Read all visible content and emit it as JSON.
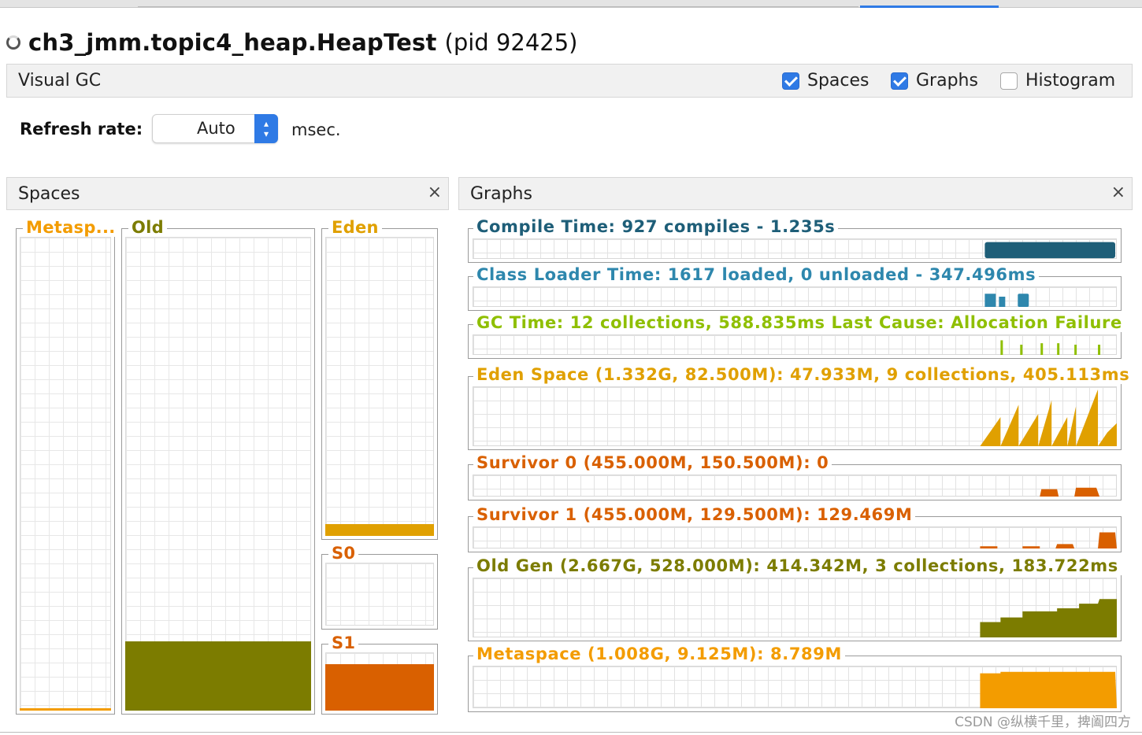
{
  "window": {
    "title_main": "ch3_jmm.topic4_heap.HeapTest",
    "title_pid": "(pid 92425)"
  },
  "plugin_bar": {
    "title": "Visual GC",
    "checkboxes": [
      {
        "label": "Spaces",
        "checked": true
      },
      {
        "label": "Graphs",
        "checked": true
      },
      {
        "label": "Histogram",
        "checked": false
      }
    ]
  },
  "refresh": {
    "label": "Refresh rate:",
    "value": "Auto",
    "unit": "msec."
  },
  "spaces_panel": {
    "title": "Spaces",
    "close": "×",
    "spaces": [
      {
        "key": "metaspace",
        "label": "Metasp...",
        "color": "#f39c00",
        "fill": 0.005
      },
      {
        "key": "old",
        "label": "Old",
        "color": "#7c7c00",
        "fill": 0.147
      },
      {
        "key": "eden",
        "label": "Eden",
        "color": "#e0a000",
        "fill": 0.04
      },
      {
        "key": "s0",
        "label": "S0",
        "color": "#d96000",
        "fill": 0.0
      },
      {
        "key": "s1",
        "label": "S1",
        "color": "#d96000",
        "fill": 0.8
      }
    ]
  },
  "graphs_panel": {
    "title": "Graphs",
    "close": "×",
    "graphs": [
      {
        "key": "compile",
        "label": "Compile Time: 927 compiles - 1.235s",
        "color": "#1e5e78"
      },
      {
        "key": "classloader",
        "label": "Class Loader Time: 1617 loaded, 0 unloaded - 347.496ms",
        "color": "#2e87ad"
      },
      {
        "key": "gc",
        "label": "GC Time: 12 collections, 588.835ms Last Cause: Allocation Failure",
        "color": "#8fbf00"
      },
      {
        "key": "eden",
        "label": "Eden Space (1.332G, 82.500M): 47.933M, 9 collections, 405.113ms",
        "color": "#e0a000"
      },
      {
        "key": "s0",
        "label": "Survivor 0 (455.000M, 150.500M): 0",
        "color": "#d96000"
      },
      {
        "key": "s1",
        "label": "Survivor 1 (455.000M, 129.500M): 129.469M",
        "color": "#d96000"
      },
      {
        "key": "old",
        "label": "Old Gen (2.667G, 528.000M): 414.342M, 3 collections, 183.722ms",
        "color": "#7c7c00"
      },
      {
        "key": "metaspace",
        "label": "Metaspace (1.008G, 9.125M): 8.789M",
        "color": "#f39c00"
      }
    ]
  },
  "watermark": "CSDN @纵横千里，捭阖四方"
}
